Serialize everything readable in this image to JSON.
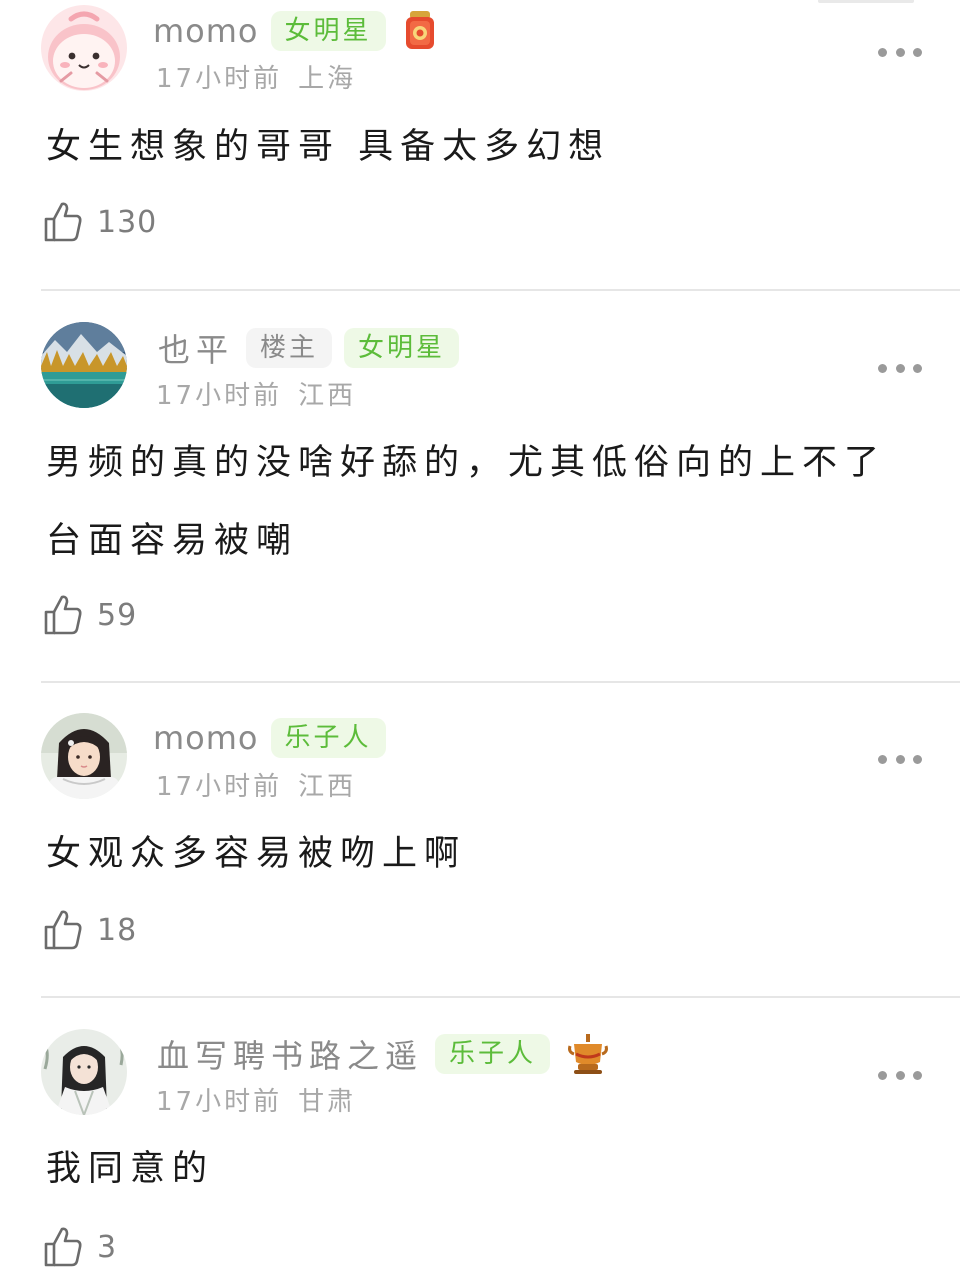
{
  "comments": [
    {
      "user": "momo",
      "badges": [
        "女明星"
      ],
      "time": "17小时前",
      "location": "上海",
      "text": "女生想象的哥哥 具备太多幻想",
      "likes": "130",
      "decoration_icon": "red-lucky-charm-icon"
    },
    {
      "user": "也平",
      "badges": [
        "楼主",
        "女明星"
      ],
      "time": "17小时前",
      "location": "江西",
      "text": "男频的真的没啥好舔的，尤其低俗向的上不了台面容易被嘲",
      "likes": "59"
    },
    {
      "user": "momo",
      "badges": [
        "乐子人"
      ],
      "time": "17小时前",
      "location": "江西",
      "text": "女观众多容易被吻上啊",
      "likes": "18"
    },
    {
      "user": "血写聘书路之遥",
      "badges": [
        "乐子人"
      ],
      "time": "17小时前",
      "location": "甘肃",
      "text": "我同意的",
      "likes": "3",
      "decoration_icon": "hotpot-icon"
    }
  ],
  "colors": {
    "badge_green_text": "#5cbc3a",
    "badge_green_bg": "#eef9e6",
    "badge_gray_bg": "#f4f4f4",
    "name_gray": "#8a8a8a",
    "meta_gray": "#a8a8a8"
  }
}
